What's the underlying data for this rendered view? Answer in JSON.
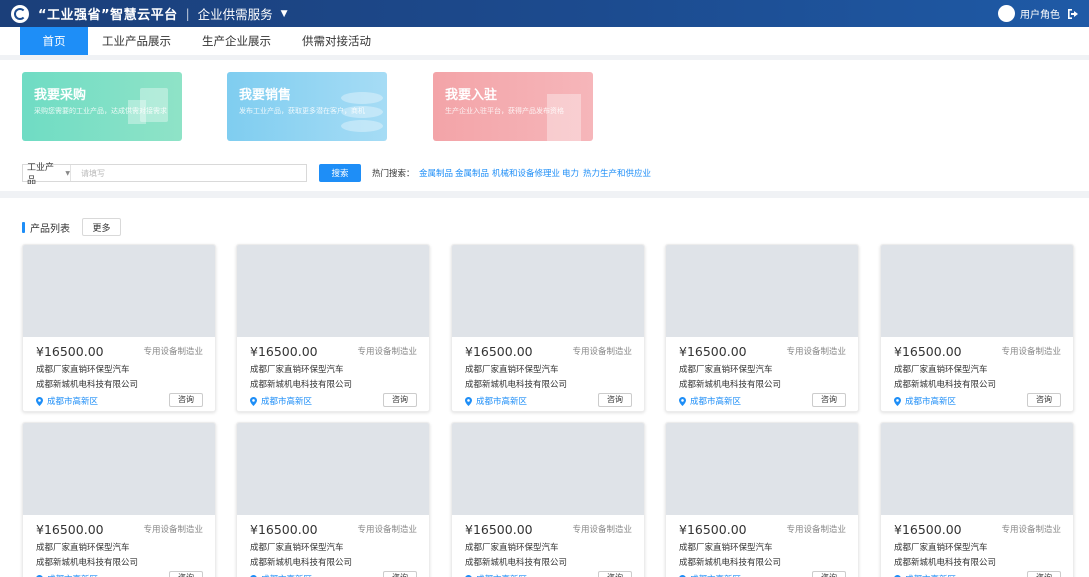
{
  "header": {
    "brand": "“工业强省”智慧云平台",
    "separator": "|",
    "service": "企业供需服务",
    "dropdown_caret": "▼",
    "user_role": "用户角色",
    "brand_color": "#1c4b8f"
  },
  "nav": {
    "items": [
      {
        "label": "首页",
        "active": true
      },
      {
        "label": "工业产品展示",
        "active": false
      },
      {
        "label": "生产企业展示",
        "active": false
      },
      {
        "label": "供需对接活动",
        "active": false
      }
    ],
    "accent_color": "#1e8ef7"
  },
  "banners": [
    {
      "title": "我要采购",
      "subtitle": "采购您需要的工业产品，达成供需对接需求",
      "color": "#6fdcc4"
    },
    {
      "title": "我要销售",
      "subtitle": "发布工业产品，获取更多潜在客户，商机",
      "color": "#7fcdf0"
    },
    {
      "title": "我要入驻",
      "subtitle": "生产企业入驻平台，获得产品发布资格",
      "color": "#f3a4a8"
    }
  ],
  "search": {
    "category": "工业产品",
    "placeholder": "请填写",
    "button": "搜索",
    "hot_label": "热门搜索：",
    "hot_terms": [
      "金属制品",
      "金属制品",
      "机械和设备修理业",
      "电力",
      "热力生产和供应业"
    ]
  },
  "products_section": {
    "title": "产品列表",
    "more_button": "更多",
    "consult_label": "咨询",
    "items": [
      {
        "price": "¥16500.00",
        "category": "专用设备制造业",
        "name": "成都厂家直销环保型汽车",
        "company": "成都新城机电科技有限公司",
        "location": "成都市高新区"
      },
      {
        "price": "¥16500.00",
        "category": "专用设备制造业",
        "name": "成都厂家直销环保型汽车",
        "company": "成都新城机电科技有限公司",
        "location": "成都市高新区"
      },
      {
        "price": "¥16500.00",
        "category": "专用设备制造业",
        "name": "成都厂家直销环保型汽车",
        "company": "成都新城机电科技有限公司",
        "location": "成都市高新区"
      },
      {
        "price": "¥16500.00",
        "category": "专用设备制造业",
        "name": "成都厂家直销环保型汽车",
        "company": "成都新城机电科技有限公司",
        "location": "成都市高新区"
      },
      {
        "price": "¥16500.00",
        "category": "专用设备制造业",
        "name": "成都厂家直销环保型汽车",
        "company": "成都新城机电科技有限公司",
        "location": "成都市高新区"
      },
      {
        "price": "¥16500.00",
        "category": "专用设备制造业",
        "name": "成都厂家直销环保型汽车",
        "company": "成都新城机电科技有限公司",
        "location": "成都市高新区"
      },
      {
        "price": "¥16500.00",
        "category": "专用设备制造业",
        "name": "成都厂家直销环保型汽车",
        "company": "成都新城机电科技有限公司",
        "location": "成都市高新区"
      },
      {
        "price": "¥16500.00",
        "category": "专用设备制造业",
        "name": "成都厂家直销环保型汽车",
        "company": "成都新城机电科技有限公司",
        "location": "成都市高新区"
      },
      {
        "price": "¥16500.00",
        "category": "专用设备制造业",
        "name": "成都厂家直销环保型汽车",
        "company": "成都新城机电科技有限公司",
        "location": "成都市高新区"
      },
      {
        "price": "¥16500.00",
        "category": "专用设备制造业",
        "name": "成都厂家直销环保型汽车",
        "company": "成都新城机电科技有限公司",
        "location": "成都市高新区"
      }
    ]
  }
}
